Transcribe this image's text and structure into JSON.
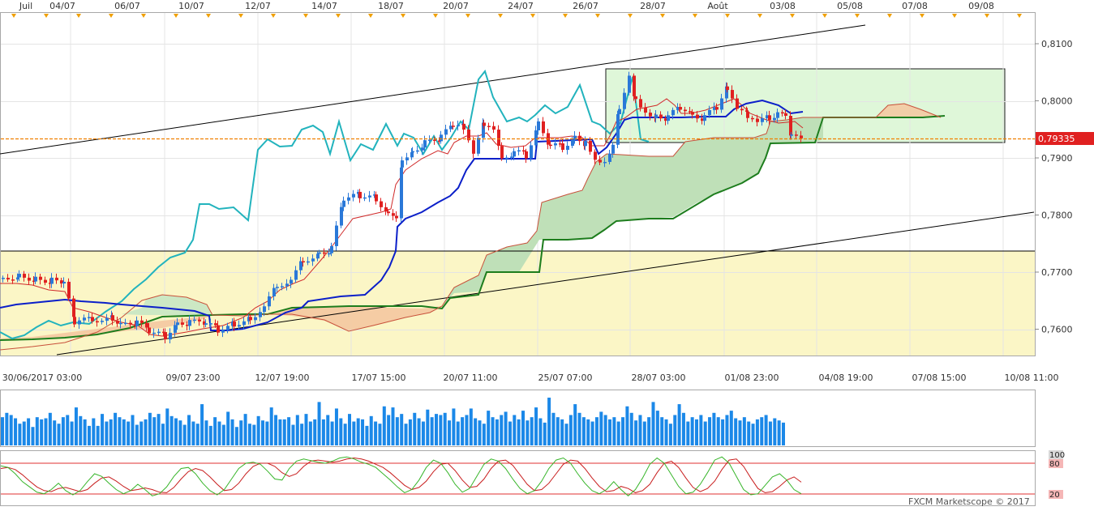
{
  "colors": {
    "background": "#ffffff",
    "grid": "#e4e4e4",
    "candle_up": "#2a78d8",
    "candle_down": "#e02020",
    "kijun": "#0b1fc9",
    "tenkan": "#d02a2a",
    "chikou": "#22b3bd",
    "senkou_b": "#1d7d1d",
    "senkou_a_edge": "#c8503a",
    "cloud_bull": "#c9e7c4",
    "cloud_bear": "#f4c9a2",
    "range_zone": "#fbf6c6",
    "box_zone": "#dff7d9",
    "trendline": "#000000",
    "current_price_line": "#f08000",
    "price_badge": "#e02020",
    "volume": "#1b88e8",
    "stoch_k": "#37b52a",
    "stoch_d": "#c81e1e",
    "stoch_level": "#e03030"
  },
  "top_axis_labels": [
    "Juil",
    "04/07",
    "06/07",
    "10/07",
    "12/07",
    "14/07",
    "18/07",
    "20/07",
    "24/07",
    "26/07",
    "28/07",
    "Août",
    "03/08",
    "05/08",
    "07/08",
    "09/08"
  ],
  "bottom_axis_labels": [
    "30/06/2017 03:00",
    "09/07 23:00",
    "12/07 19:00",
    "17/07 15:00",
    "20/07 11:00",
    "25/07 07:00",
    "28/07 03:00",
    "01/08 23:00",
    "04/08 19:00",
    "07/08 15:00",
    "10/08 11:00"
  ],
  "price_ticks": [
    "0,8100",
    "0,8000",
    "0,7900",
    "0,7800",
    "0,7700",
    "0,7600"
  ],
  "current_price": "0,79335",
  "stoch_ticks": [
    "100",
    "80",
    "20"
  ],
  "watermark": "FXCM Marketscope © 2017",
  "chart_data": [
    {
      "type": "candlestick",
      "x_axis": "time",
      "ylim": [
        0.755,
        0.8135
      ],
      "current_price": 0.79335,
      "horizontal_line": 0.7737,
      "zones": [
        {
          "label": "range",
          "y": [
            0.755,
            0.7737
          ]
        },
        {
          "label": "box",
          "y": [
            0.7925,
            0.8055
          ]
        }
      ],
      "trendlines": [
        {
          "from": [
            0,
            0.7925
          ],
          "to": [
            1067,
            0.813
          ]
        },
        {
          "from": [
            70,
            0.7553
          ],
          "to": [
            1275,
            0.7807
          ]
        }
      ],
      "candles_summary": {
        "first_close": 0.768,
        "low": 0.7577,
        "high": 0.8062,
        "last_close": 0.79335
      },
      "indicators": [
        "Tenkan",
        "Kijun",
        "Chikou",
        "Senkou A",
        "Senkou B"
      ]
    },
    {
      "type": "bar",
      "name": "volume",
      "values": [
        2.6,
        3.0,
        2.8,
        2.5,
        2.0,
        2.2,
        2.5,
        1.7,
        2.6,
        2.4,
        2.5,
        3.0,
        2.3,
        2.0,
        2.6,
        2.8,
        2.2,
        3.5,
        2.7,
        2.4,
        1.8,
        2.5,
        1.8,
        2.9,
        2.2,
        2.4,
        3.0,
        2.6,
        2.4,
        2.2,
        2.8,
        1.9,
        2.2,
        2.4,
        3.0,
        2.6,
        2.9,
        2.0,
        3.4,
        2.7,
        2.5,
        2.3,
        1.9,
        2.8,
        2.2,
        2.0,
        3.8,
        2.3,
        1.8,
        2.6,
        2.2,
        1.9,
        3.1,
        2.4,
        1.7,
        2.3,
        2.9,
        2.0,
        1.9,
        2.7,
        2.3,
        2.2,
        3.5,
        2.8,
        2.4,
        2.4,
        2.6,
        1.9,
        2.8,
        2.0,
        2.9,
        2.2,
        2.4,
        4.0,
        2.4,
        2.8,
        2.2,
        3.4,
        2.5,
        2.0,
        2.9,
        2.2,
        2.5,
        2.4,
        1.8,
        2.7,
        2.2,
        2.0,
        3.6,
        2.8,
        3.5,
        2.6,
        2.9,
        2.0,
        2.4,
        3.0,
        2.5,
        2.2,
        3.3,
        2.6,
        2.9,
        2.8,
        3.0,
        2.3,
        3.4,
        2.2,
        2.6,
        2.8,
        3.4,
        2.5,
        2.3,
        2.0,
        3.2,
        2.6,
        2.4,
        2.8,
        3.1,
        2.2,
        2.8,
        2.4,
        3.2,
        2.3,
        2.6,
        3.5,
        2.5,
        2.1,
        4.4,
        3.0,
        2.6,
        2.4,
        2.0,
        2.8,
        3.8,
        3.0,
        2.6,
        2.4,
        2.2,
        2.6,
        3.1,
        2.8,
        2.4,
        2.6,
        2.2,
        2.6,
        3.6,
        3.0,
        2.3,
        2.8,
        2.2,
        2.6,
        4.0,
        3.2,
        2.6,
        2.4,
        2.0,
        2.8,
        3.8,
        3.0,
        2.2,
        2.6,
        2.4,
        2.8,
        2.2,
        2.6,
        3.0,
        2.6,
        2.4,
        2.8,
        3.2,
        2.5,
        2.3,
        2.6,
        2.2,
        2.0,
        2.4,
        2.6,
        2.8,
        2.2,
        2.5,
        2.3,
        2.1
      ],
      "ylim": [
        0,
        5
      ]
    },
    {
      "type": "line",
      "name": "stochastic",
      "ylim": [
        0,
        100
      ],
      "levels": [
        20,
        80
      ],
      "series": [
        {
          "name": "%K",
          "values": [
            75,
            72,
            60,
            45,
            35,
            25,
            22,
            30,
            42,
            28,
            20,
            28,
            45,
            60,
            55,
            42,
            30,
            22,
            28,
            40,
            30,
            18,
            22,
            35,
            55,
            70,
            72,
            60,
            42,
            28,
            20,
            30,
            50,
            70,
            80,
            82,
            78,
            65,
            50,
            48,
            70,
            84,
            88,
            85,
            82,
            80,
            84,
            90,
            92,
            88,
            82,
            78,
            72,
            60,
            48,
            35,
            24,
            30,
            48,
            72,
            86,
            80,
            62,
            40,
            25,
            32,
            55,
            78,
            88,
            84,
            70,
            50,
            32,
            22,
            28,
            46,
            70,
            86,
            90,
            80,
            60,
            42,
            28,
            22,
            30,
            45,
            30,
            18,
            30,
            52,
            78,
            90,
            80,
            58,
            36,
            22,
            25,
            40,
            62,
            86,
            92,
            80,
            55,
            30,
            20,
            22,
            38,
            54,
            60,
            48,
            30,
            22
          ]
        },
        {
          "name": "%D",
          "values": [
            70,
            72,
            68,
            58,
            46,
            35,
            28,
            26,
            32,
            34,
            30,
            26,
            30,
            42,
            52,
            54,
            46,
            36,
            28,
            30,
            33,
            30,
            25,
            24,
            34,
            50,
            64,
            70,
            66,
            54,
            40,
            28,
            30,
            42,
            60,
            74,
            80,
            80,
            74,
            62,
            55,
            60,
            74,
            84,
            86,
            84,
            82,
            84,
            88,
            90,
            88,
            84,
            78,
            72,
            62,
            50,
            38,
            30,
            34,
            46,
            64,
            78,
            80,
            66,
            48,
            34,
            36,
            50,
            70,
            84,
            86,
            76,
            58,
            40,
            28,
            30,
            42,
            60,
            78,
            86,
            84,
            70,
            52,
            36,
            26,
            28,
            36,
            32,
            24,
            28,
            40,
            62,
            80,
            84,
            72,
            52,
            34,
            26,
            32,
            46,
            68,
            86,
            88,
            74,
            52,
            32,
            24,
            26,
            36,
            48,
            54,
            44
          ]
        }
      ]
    }
  ]
}
